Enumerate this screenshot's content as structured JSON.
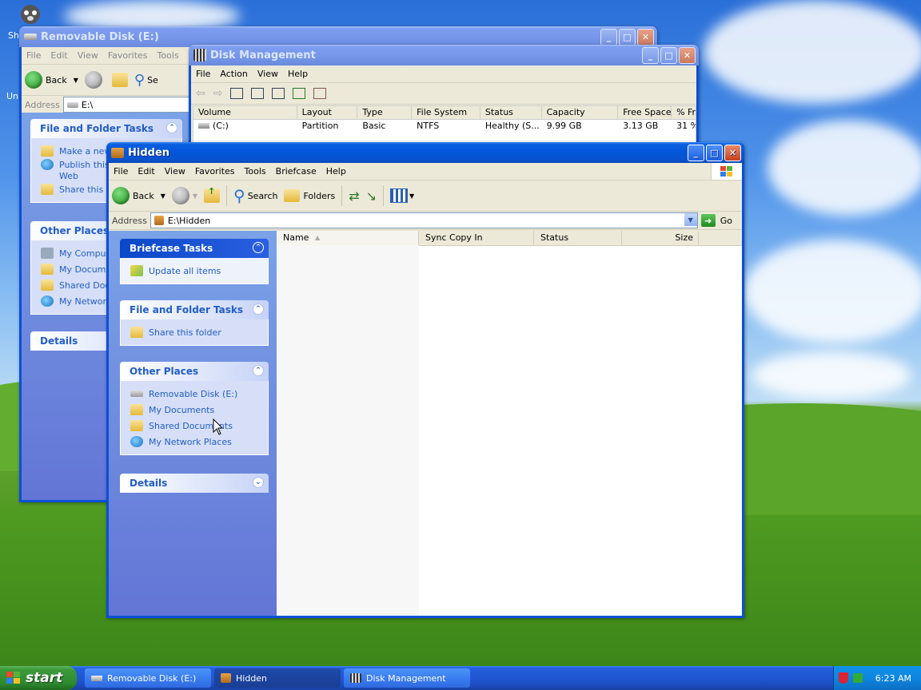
{
  "desktop": {
    "icon_label_1": "Sh",
    "icon_label_2": "Un"
  },
  "removable_window": {
    "title": "Removable Disk (E:)",
    "menu": [
      "File",
      "Edit",
      "View",
      "Favorites",
      "Tools"
    ],
    "toolbar": {
      "back_label": "Back",
      "search_label": "Se"
    },
    "address_label": "Address",
    "address_value": "E:\\",
    "file_folder_tasks": {
      "title": "File and Folder Tasks",
      "items": [
        "Make a new",
        "Publish this",
        "Web",
        "Share this fo"
      ]
    },
    "other_places": {
      "title": "Other Places",
      "items": [
        "My Compute",
        "My Documer",
        "Shared Docu",
        "My Network"
      ]
    },
    "details_title": "Details"
  },
  "disk_mgmt_window": {
    "title": "Disk Management",
    "menu": [
      "File",
      "Action",
      "View",
      "Help"
    ],
    "columns": [
      "Volume",
      "Layout",
      "Type",
      "File System",
      "Status",
      "Capacity",
      "Free Space",
      "% Fr"
    ],
    "rows": [
      {
        "volume": "(C:)",
        "layout": "Partition",
        "type": "Basic",
        "fs": "NTFS",
        "status": "Healthy (S...",
        "capacity": "9.99 GB",
        "free": "3.13 GB",
        "pct": "31 %"
      }
    ]
  },
  "hidden_window": {
    "title": "Hidden",
    "menu": [
      "File",
      "Edit",
      "View",
      "Favorites",
      "Tools",
      "Briefcase",
      "Help"
    ],
    "toolbar": {
      "back_label": "Back",
      "search_label": "Search",
      "folders_label": "Folders"
    },
    "address_label": "Address",
    "address_value": "E:\\Hidden",
    "go_label": "Go",
    "briefcase_tasks": {
      "title": "Briefcase Tasks",
      "items": [
        "Update all items"
      ]
    },
    "file_folder_tasks": {
      "title": "File and Folder Tasks",
      "items": [
        "Share this folder"
      ]
    },
    "other_places": {
      "title": "Other Places",
      "items": [
        "Removable Disk (E:)",
        "My Documents",
        "Shared Documents",
        "My Network Places"
      ]
    },
    "details_title": "Details",
    "columns": [
      "Name",
      "Sync Copy In",
      "Status",
      "Size"
    ]
  },
  "taskbar": {
    "start_label": "start",
    "tasks": [
      "Removable Disk (E:)",
      "Hidden",
      "Disk Management"
    ],
    "clock": "6:23 AM"
  },
  "colors": {
    "xp_blue": "#0a50d8",
    "task_link": "#215dc6",
    "start_green": "#3c9a3c"
  }
}
